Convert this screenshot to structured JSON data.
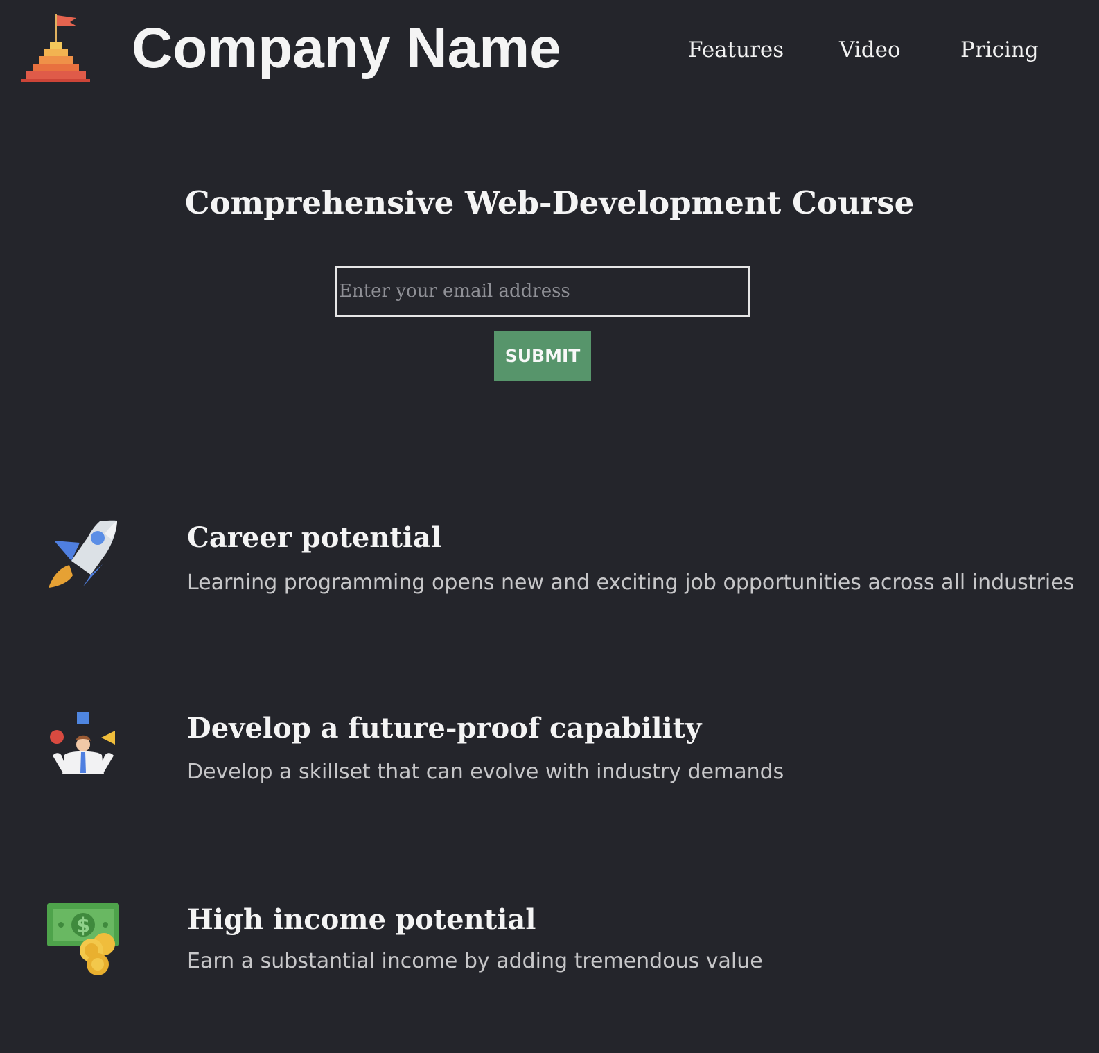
{
  "header": {
    "logo_icon": "summit-flag-icon",
    "company_name": "Company Name",
    "nav": {
      "features": "Features",
      "video": "Video",
      "pricing": "Pricing"
    }
  },
  "hero": {
    "title": "Comprehensive Web-Development Course",
    "email_placeholder": "Enter your email address",
    "email_value": "",
    "submit_label": "SUBMIT"
  },
  "features": [
    {
      "icon": "rocket-icon",
      "title": "Career potential",
      "description": "Learning programming opens new and exciting job opportunities across all industries"
    },
    {
      "icon": "juggling-person-icon",
      "title": "Develop a future-proof capability",
      "description": "Develop a skillset that can evolve with industry demands"
    },
    {
      "icon": "money-icon",
      "title": "High income potential",
      "description": "Earn a substantial income by adding tremendous value"
    }
  ],
  "colors": {
    "background": "#24252b",
    "text": "#f4f4f4",
    "muted_text": "#c7c7c9",
    "submit_button": "#57956b"
  }
}
